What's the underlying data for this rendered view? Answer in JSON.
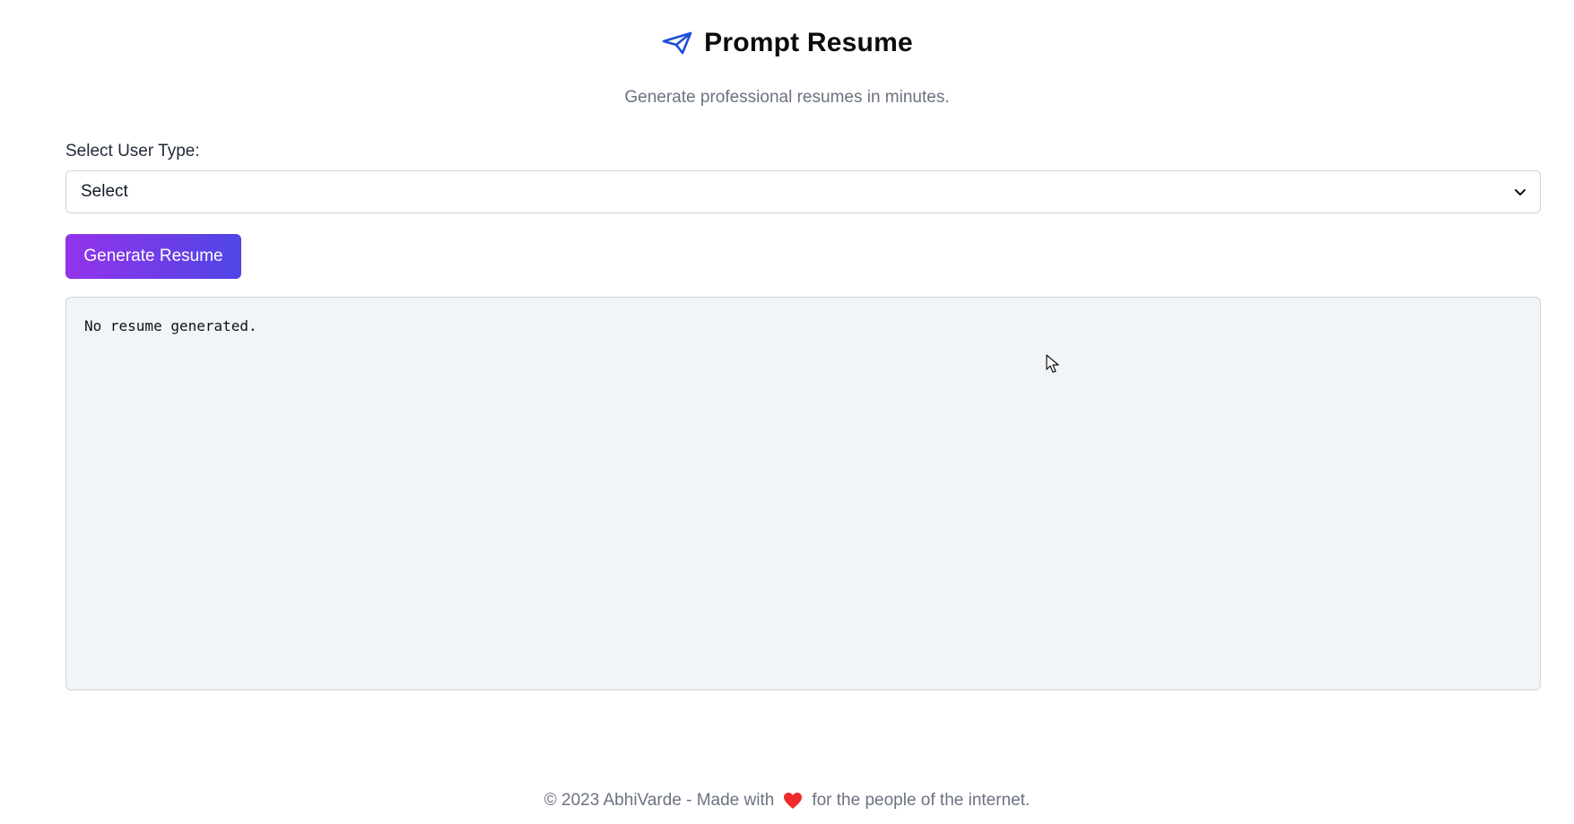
{
  "header": {
    "logo_icon": "paper-plane-icon",
    "title": "Prompt Resume",
    "subtitle": "Generate professional resumes in minutes."
  },
  "form": {
    "user_type_label": "Select User Type:",
    "user_type_selected": "Select",
    "dropdown_icon": "chevron-down-icon",
    "generate_button_label": "Generate Resume"
  },
  "output": {
    "text": "No resume generated."
  },
  "footer": {
    "text_before": "© 2023 AbhiVarde - Made with",
    "heart_icon": "heart-icon",
    "text_after": "for the people of the internet."
  },
  "colors": {
    "accent_start": "#9333ea",
    "accent_end": "#4f46e5",
    "logo": "#1d4ed8",
    "heart": "#ef2b2b"
  }
}
